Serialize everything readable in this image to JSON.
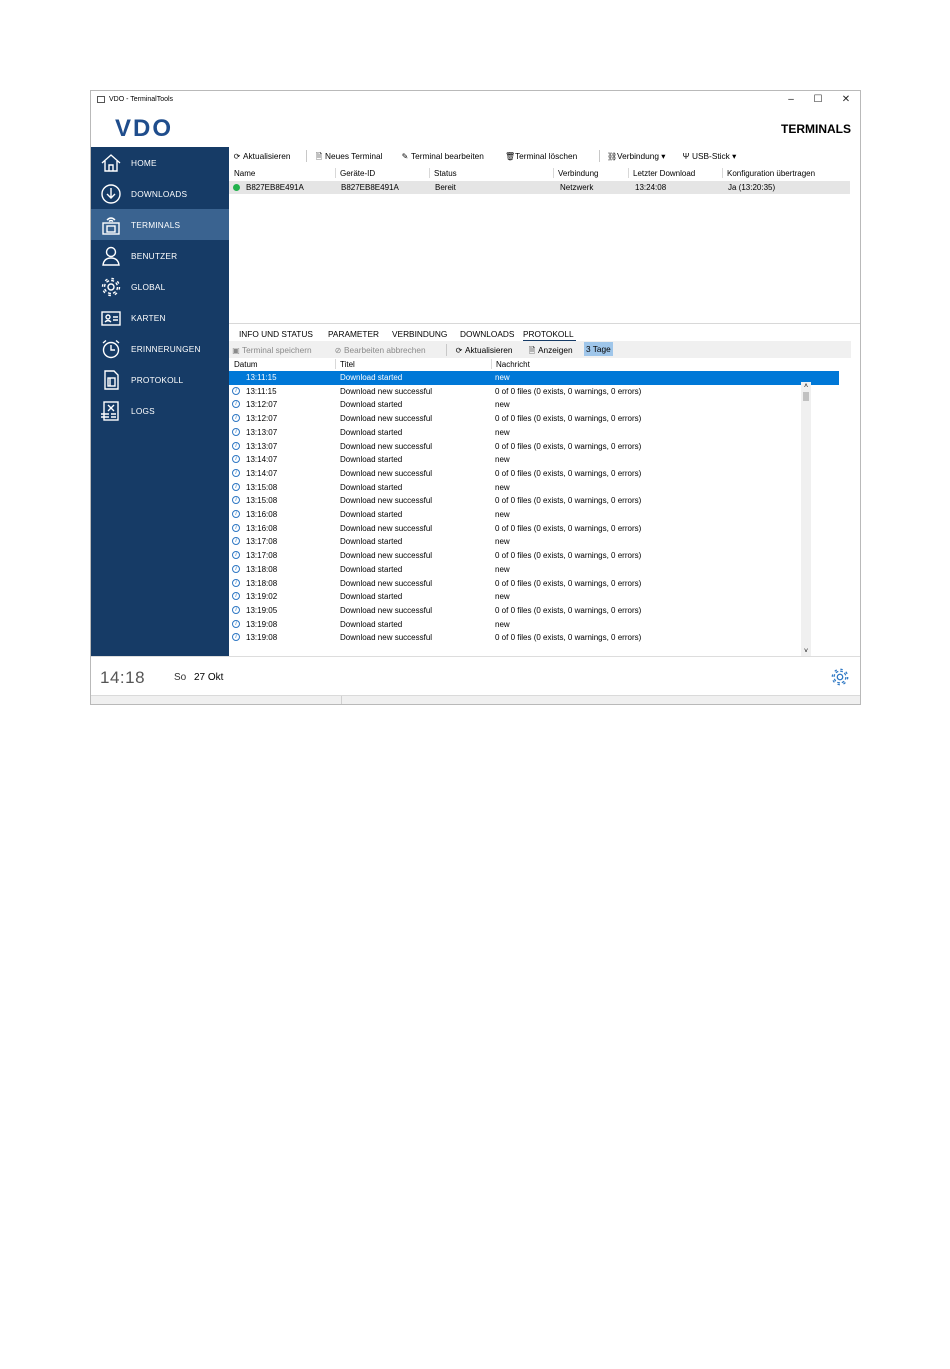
{
  "window": {
    "title": "VDO - TerminalTools"
  },
  "header": {
    "logo_text": "VDO",
    "page_title": "TERMINALS"
  },
  "sidebar": {
    "items": [
      {
        "label": "HOME",
        "icon": "home-icon"
      },
      {
        "label": "DOWNLOADS",
        "icon": "download-icon"
      },
      {
        "label": "TERMINALS",
        "icon": "terminal-icon",
        "active": true
      },
      {
        "label": "BENUTZER",
        "icon": "user-icon"
      },
      {
        "label": "GLOBAL",
        "icon": "gear-icon"
      },
      {
        "label": "KARTEN",
        "icon": "card-icon"
      },
      {
        "label": "ERINNERUNGEN",
        "icon": "alarm-clock-icon"
      },
      {
        "label": "PROTOKOLL",
        "icon": "document-icon"
      },
      {
        "label": "LOGS",
        "icon": "log-file-icon"
      }
    ]
  },
  "toolbar": {
    "refresh": "Aktualisieren",
    "new_terminal": "Neues Terminal",
    "edit_terminal": "Terminal bearbeiten",
    "delete_terminal": "Terminal löschen",
    "connection": "Verbindung",
    "usb": "USB-Stick"
  },
  "terminals": {
    "columns": [
      "Name",
      "Geräte-ID",
      "Status",
      "Verbindung",
      "Letzter Download",
      "Konfiguration übertragen"
    ],
    "rows": [
      {
        "name": "B827EB8E491A",
        "device_id": "B827EB8E491A",
        "status": "Bereit",
        "connection": "Netzwerk",
        "last_download": "13:24:08",
        "config": "Ja (13:20:35)"
      }
    ]
  },
  "tabs": [
    "INFO UND STATUS",
    "PARAMETER",
    "VERBINDUNG",
    "DOWNLOADS",
    "PROTOKOLL"
  ],
  "log_toolbar": {
    "save": "Terminal speichern",
    "cancel": "Bearbeiten abbrechen",
    "refresh": "Aktualisieren",
    "show": "Anzeigen",
    "range": "3 Tage"
  },
  "log": {
    "columns": [
      "Datum",
      "Titel",
      "Nachricht"
    ],
    "rows": [
      {
        "time": "13:11:15",
        "title": "Download started",
        "message": "new"
      },
      {
        "time": "13:11:15",
        "title": "Download new successful",
        "message": "0 of 0 files (0 exists, 0 warnings, 0 errors)"
      },
      {
        "time": "13:12:07",
        "title": "Download started",
        "message": "new"
      },
      {
        "time": "13:12:07",
        "title": "Download new successful",
        "message": "0 of 0 files (0 exists, 0 warnings, 0 errors)"
      },
      {
        "time": "13:13:07",
        "title": "Download started",
        "message": "new"
      },
      {
        "time": "13:13:07",
        "title": "Download new successful",
        "message": "0 of 0 files (0 exists, 0 warnings, 0 errors)"
      },
      {
        "time": "13:14:07",
        "title": "Download started",
        "message": "new"
      },
      {
        "time": "13:14:07",
        "title": "Download new successful",
        "message": "0 of 0 files (0 exists, 0 warnings, 0 errors)"
      },
      {
        "time": "13:15:08",
        "title": "Download started",
        "message": "new"
      },
      {
        "time": "13:15:08",
        "title": "Download new successful",
        "message": "0 of 0 files (0 exists, 0 warnings, 0 errors)"
      },
      {
        "time": "13:16:08",
        "title": "Download started",
        "message": "new"
      },
      {
        "time": "13:16:08",
        "title": "Download new successful",
        "message": "0 of 0 files (0 exists, 0 warnings, 0 errors)"
      },
      {
        "time": "13:17:08",
        "title": "Download started",
        "message": "new"
      },
      {
        "time": "13:17:08",
        "title": "Download new successful",
        "message": "0 of 0 files (0 exists, 0 warnings, 0 errors)"
      },
      {
        "time": "13:18:08",
        "title": "Download started",
        "message": "new"
      },
      {
        "time": "13:18:08",
        "title": "Download new successful",
        "message": "0 of 0 files (0 exists, 0 warnings, 0 errors)"
      },
      {
        "time": "13:19:02",
        "title": "Download started",
        "message": "new"
      },
      {
        "time": "13:19:05",
        "title": "Download new successful",
        "message": "0 of 0 files (0 exists, 0 warnings, 0 errors)"
      },
      {
        "time": "13:19:08",
        "title": "Download started",
        "message": "new"
      },
      {
        "time": "13:19:08",
        "title": "Download new successful",
        "message": "0 of 0 files (0 exists, 0 warnings, 0 errors)"
      }
    ]
  },
  "footer": {
    "time": "14:18",
    "weekday": "So",
    "date": "27 Okt"
  },
  "colors": {
    "sidebar": "#163b66",
    "sidebar_active": "#3a6390",
    "selection": "#0078d7",
    "brand": "#1f4d8c",
    "status_ok": "#22b14c"
  }
}
